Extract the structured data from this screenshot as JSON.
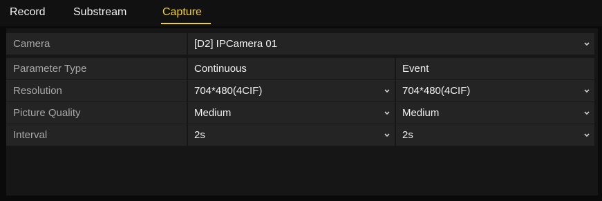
{
  "tabs": [
    {
      "label": "Record"
    },
    {
      "label": "Substream"
    },
    {
      "label": "Capture"
    }
  ],
  "active_tab": "Capture",
  "colors": {
    "accent": "#f4d21f",
    "background": "#0a0a0a",
    "cell": "#242424"
  },
  "camera": {
    "label": "Camera",
    "value": "[D2] IPCamera 01"
  },
  "table": {
    "header": {
      "label": "Parameter Type",
      "col1": "Continuous",
      "col2": "Event"
    },
    "rows": [
      {
        "label": "Resolution",
        "col1": "704*480(4CIF)",
        "col2": "704*480(4CIF)"
      },
      {
        "label": "Picture Quality",
        "col1": "Medium",
        "col2": "Medium"
      },
      {
        "label": "Interval",
        "col1": "2s",
        "col2": "2s"
      }
    ]
  },
  "icons": {
    "dropdown": "chevron-down-icon"
  }
}
